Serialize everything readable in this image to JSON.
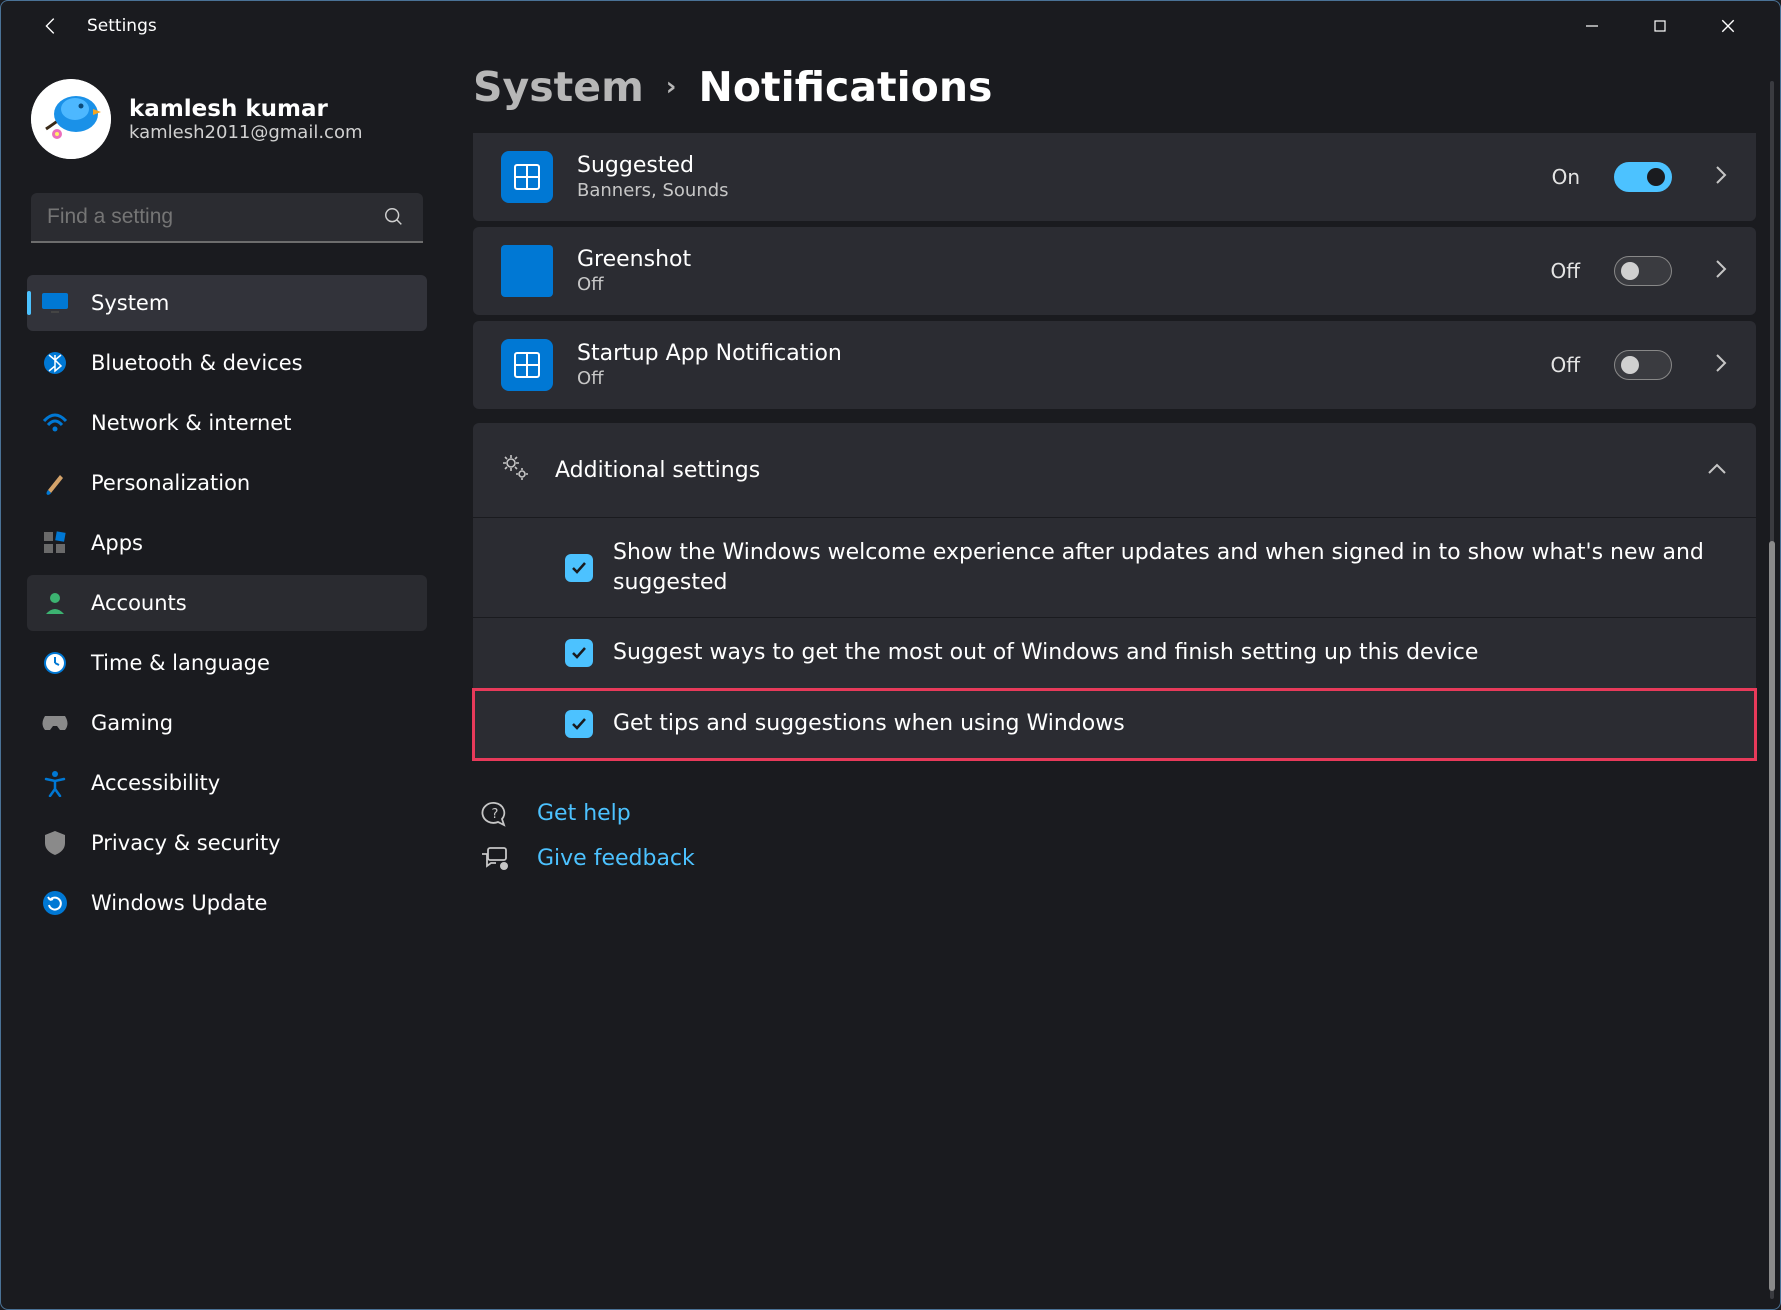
{
  "window": {
    "title": "Settings"
  },
  "user": {
    "name": "kamlesh kumar",
    "email": "kamlesh2011@gmail.com"
  },
  "search": {
    "placeholder": "Find a setting"
  },
  "nav": {
    "items": [
      {
        "label": "System"
      },
      {
        "label": "Bluetooth & devices"
      },
      {
        "label": "Network & internet"
      },
      {
        "label": "Personalization"
      },
      {
        "label": "Apps"
      },
      {
        "label": "Accounts"
      },
      {
        "label": "Time & language"
      },
      {
        "label": "Gaming"
      },
      {
        "label": "Accessibility"
      },
      {
        "label": "Privacy & security"
      },
      {
        "label": "Windows Update"
      }
    ]
  },
  "breadcrumb": {
    "parent": "System",
    "current": "Notifications"
  },
  "apps": [
    {
      "title": "Suggested",
      "sub": "Banners, Sounds",
      "state_label": "On",
      "on": true
    },
    {
      "title": "Greenshot",
      "sub": "Off",
      "state_label": "Off",
      "on": false
    },
    {
      "title": "Startup App Notification",
      "sub": "Off",
      "state_label": "Off",
      "on": false
    }
  ],
  "additional": {
    "header": "Additional settings",
    "items": [
      {
        "label": "Show the Windows welcome experience after updates and when signed in to show what's new and suggested",
        "checked": true
      },
      {
        "label": "Suggest ways to get the most out of Windows and finish setting up this device",
        "checked": true
      },
      {
        "label": "Get tips and suggestions when using Windows",
        "checked": true
      }
    ]
  },
  "footer": {
    "help": "Get help",
    "feedback": "Give feedback"
  }
}
